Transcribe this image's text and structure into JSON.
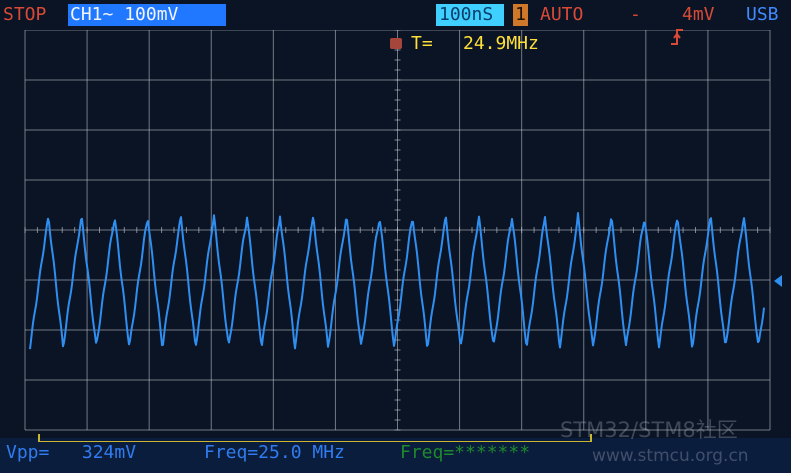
{
  "status_bar": {
    "run_state": "STOP",
    "channel": "CH1",
    "coupling": "~",
    "volts_per_div": "100mV",
    "timebase": "100nS",
    "trigger_channel": "1",
    "trigger_mode": "AUTO",
    "trigger_edge_icon": "rising-edge-icon",
    "trigger_separator": "-",
    "trigger_level": "4mV",
    "connection": "USB"
  },
  "frequency_readout": {
    "label": "T=",
    "value": "24.9MHz"
  },
  "measurements": {
    "vpp": "Vpp=   324mV",
    "freq": "Freq=25.0 MHz",
    "freq_secondary": "Freq=*******"
  },
  "watermark": {
    "brand": "STM32/STM8社区",
    "url": "www.stmcu.org.cn"
  },
  "colors": {
    "background": "#0a1424",
    "grid": "#c8ccd6",
    "trace": "#2f8ef0",
    "run_state": "#d84a36",
    "channel_box": "#1f78ff",
    "timebase_box": "#3fd0ff",
    "trigger_box": "#d0782a",
    "readout": "#ffe03a",
    "measure": "#2f7cf0",
    "measure_secondary": "#1e8a2c"
  },
  "waveform": {
    "frequency_mhz": 25.0,
    "amplitude_mv": 324,
    "cycles_visible": 22.5,
    "shape": "triangle"
  },
  "trigger_marker_icon": "trigger-level-arrow-icon"
}
